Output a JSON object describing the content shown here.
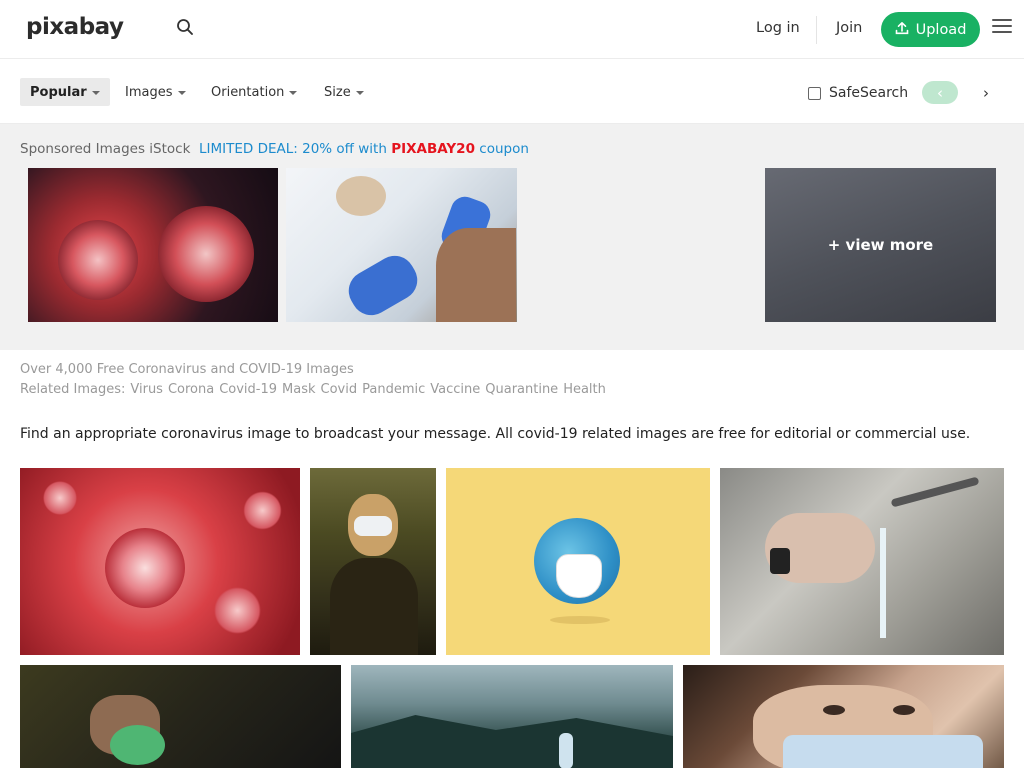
{
  "header": {
    "logo": "pixabay",
    "login_label": "Log in",
    "join_label": "Join",
    "upload_label": "Upload"
  },
  "filters": {
    "popular": "Popular",
    "images": "Images",
    "orientation": "Orientation",
    "size": "Size",
    "safesearch_label": "SafeSearch",
    "safesearch_checked": false,
    "prev": "‹",
    "next": "›"
  },
  "sponsored": {
    "label": "Sponsored Images iStock",
    "deal_prefix": "LIMITED DEAL: 20% off with",
    "code": "PIXABAY20",
    "deal_suffix": "coupon",
    "view_more": "+ view more"
  },
  "meta": {
    "count_text": "Over 4,000 Free Coronavirus and COVID-19 Images",
    "related_label": "Related Images:",
    "related_tags": [
      "Virus",
      "Corona",
      "Covid-19",
      "Mask",
      "Covid",
      "Pandemic",
      "Vaccine",
      "Quarantine",
      "Health"
    ]
  },
  "description": "Find an appropriate coronavirus image to broadcast your message. All covid-19 related images are free for editorial or commercial use.",
  "colors": {
    "brand_green": "#19b163",
    "deal_blue": "#1c8bcd",
    "code_red": "#e5141e"
  }
}
